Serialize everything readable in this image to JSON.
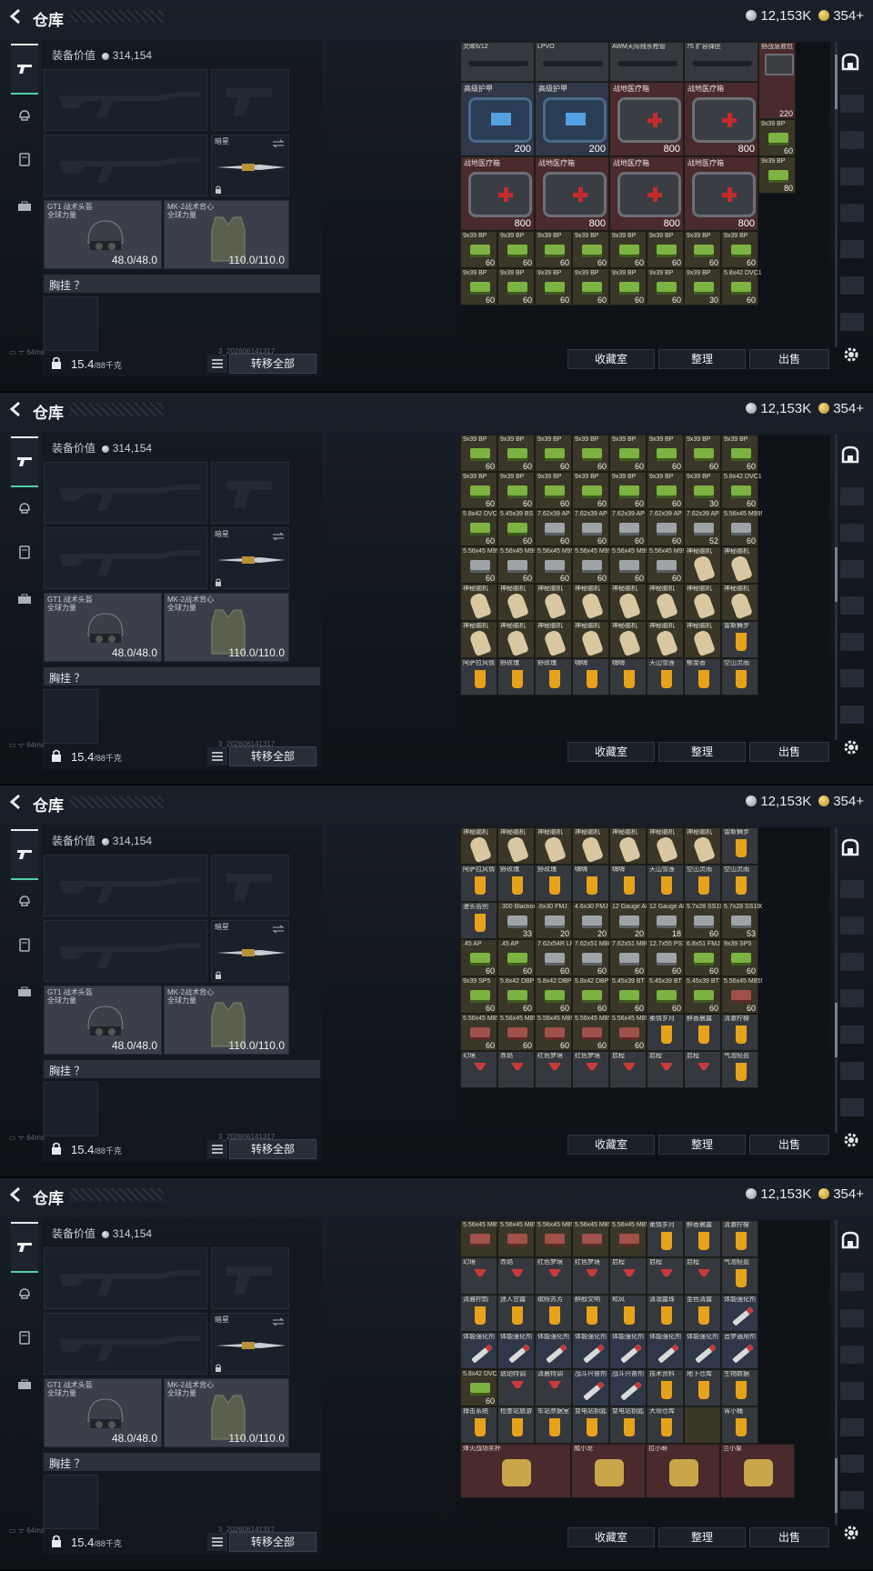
{
  "title": "仓库",
  "currency": {
    "silver": "12,153K",
    "gold": "354+"
  },
  "equipment_value_label": "装备价值",
  "equipment_value": "314,154",
  "slots": {
    "melee_name": "暗星",
    "helmet_name": "GT1 战术头盔",
    "helmet_sub": "全球力量",
    "helmet_dur": "48.0/48.0",
    "vest_name": "MK-2战术背心",
    "vest_sub": "全球力量",
    "vest_dur": "110.0/110.0"
  },
  "chest_rig_label": "胸挂 ？",
  "weight": "15.4",
  "weight_unit": "/88千克",
  "transfer_all": "转移全部",
  "buttons": {
    "collection": "收藏室",
    "sort": "整理",
    "sell": "出售"
  },
  "status": {
    "ping": "64ms",
    "build": "3_202606141317"
  },
  "icons": [
    "back-icon",
    "gun-tab-icon",
    "helmet-tab-icon",
    "vest-tab-icon",
    "case-tab-icon",
    "lock-icon",
    "list-icon",
    "gear-icon",
    "backpack-icon"
  ],
  "frames": [
    {
      "scroll": 0.05,
      "top_row": [
        {
          "nm": "灵眸6/12"
        },
        {
          "nm": "LPVO"
        },
        {
          "nm": "AWM天际线长枪管"
        },
        {
          "nm": "75 扩容弹匣"
        }
      ],
      "big": [
        {
          "nm": "高级护甲",
          "ct": "200",
          "style": "blue"
        },
        {
          "nm": "高级护甲",
          "ct": "200",
          "style": "blue"
        },
        {
          "nm": "战地医疗箱",
          "ct": "800",
          "style": "red"
        },
        {
          "nm": "战地医疗箱",
          "ct": "800",
          "style": "red"
        },
        {
          "nm": "战地医疗箱",
          "ct": "800",
          "style": "red"
        },
        {
          "nm": "战地医疗箱",
          "ct": "800",
          "style": "red"
        },
        {
          "nm": "战地医疗箱",
          "ct": "800",
          "style": "red"
        },
        {
          "nm": "战地医疗箱",
          "ct": "800",
          "style": "red"
        }
      ],
      "side": [
        {
          "nm": "野战急救包",
          "ct": "220"
        },
        {
          "nm": "9x39 BP",
          "ct": "60"
        },
        {
          "nm": "9x39 BP",
          "ct": "80"
        }
      ],
      "rows": [
        [
          "9x39 BP|60",
          "9x39 BP|60",
          "9x39 BP|60",
          "9x39 BP|60",
          "9x39 BP|60",
          "9x39 BP|60",
          "9x39 BP|60",
          "9x39 BP|60"
        ],
        [
          "9x39 BP|60",
          "9x39 BP|60",
          "9x39 BP|60",
          "9x39 BP|60",
          "9x39 BP|60",
          "9x39 BP|60",
          "9x39 BP|30",
          "5.8x42 DVC12|60"
        ]
      ]
    },
    {
      "scroll": 0.45,
      "rows": [
        [
          "9x39 BP|60",
          "9x39 BP|60",
          "9x39 BP|60",
          "9x39 BP|60",
          "9x39 BP|60",
          "9x39 BP|60",
          "9x39 BP|60",
          "9x39 BP|60"
        ],
        [
          "9x39 BP|60",
          "9x39 BP|60",
          "9x39 BP|60",
          "9x39 BP|60",
          "9x39 BP|60",
          "9x39 BP|60",
          "9x39 BP|30",
          "5.8x42 DVC12|60"
        ],
        [
          "5.8x42 DVC12|60",
          "5.45x39 BS|60",
          "7.62x39 AP|60",
          "7.62x39 AP|60",
          "7.62x39 AP|60",
          "7.62x39 AP|60",
          "7.62x39 AP|52",
          "5.56x45 M995|60"
        ],
        [
          "5.56x45 M995|60",
          "5.56x45 M995|60",
          "5.56x45 M995|60",
          "5.56x45 M995|60",
          "5.56x45 M995|60",
          "5.56x45 M995|60",
          "神秘脑机|",
          "神秘脑机|"
        ],
        [
          "神秘脑机|",
          "神秘脑机|",
          "神秘脑机|",
          "神秘脑机|",
          "神秘脑机|",
          "神秘脑机|",
          "神秘脑机|",
          "神秘脑机|"
        ],
        [
          "神秘脑机|",
          "神秘脑机|",
          "神秘脑机|",
          "神秘脑机|",
          "神秘脑机|",
          "神秘脑机|",
          "神秘脑机|",
          "雷斯舞步|"
        ],
        [
          "阿萨拉风情|",
          "野玫瑰|",
          "野玫瑰|",
          "嗨嗨|",
          "嗨嗨|",
          "天山雪莲|",
          "郁金香|",
          "空山灵雨|"
        ]
      ]
    },
    {
      "scroll": 0.7,
      "rows": [
        [
          "神秘脑机|",
          "神秘脑机|",
          "神秘脑机|",
          "神秘脑机|",
          "神秘脑机|",
          "神秘脑机|",
          "神秘脑机|",
          "雷斯舞步|"
        ],
        [
          "阿萨拉风情|",
          "野玫瑰|",
          "野玫瑰|",
          "嗨嗨|",
          "嗨嗨|",
          "天山雪莲|",
          "空山灵雨|",
          "空山灵雨|"
        ],
        [
          "漫长告别|",
          ".300 Blackout|33",
          ".6x30 FMJ|20",
          "4.6x30 FMJ|20",
          "12 Gauge AP|20",
          "12 Gauge AP|18",
          "5.7x28 SS190|60",
          "5.7x28 SS190|53"
        ],
        [
          ".45 AP|60",
          ".45 AP|60",
          "7.62x54R LPS|60",
          "7.62x51 M80|60",
          "7.62x51 M80|60",
          "12.7x55 PS12|60",
          "6.8x51 FMJ|60",
          "9x39 SP5|60"
        ],
        [
          "9x39 SP5|60",
          "5.8x42 DBP10|60",
          "5.8x42 DBP10|60",
          "5.8x42 DBP10|60",
          "5.45x39 BT|60",
          "5.45x39 BT|60",
          "5.45x39 BT|60",
          "5.56x45 M855A1|60"
        ],
        [
          "5.56x45 M855A1|60",
          "5.56x45 M855A1|60",
          "5.56x45 M855A1|60",
          "5.56x45 M855A1|60",
          "5.56x45 M855A1|60",
          "柔情岁月|",
          "醉香晨露|",
          "清澈柠檬|"
        ],
        [
          "幻境|",
          "赤焰|",
          "红色梦境|",
          "红色梦境|",
          "启程|",
          "启程|",
          "启程|",
          "气泡轻盈|"
        ]
      ]
    },
    {
      "scroll": 0.95,
      "rows": [
        [
          "5.56x45 M855A1|",
          "5.56x45 M855A1|",
          "5.56x45 M855A1|",
          "5.56x45 M855A1|",
          "5.56x45 M855A1|",
          "柔情岁月|",
          "醉香晨露|",
          "清澈柠檬|"
        ],
        [
          "幻境|",
          "赤焰|",
          "红色梦境|",
          "红色梦境|",
          "启程|",
          "启程|",
          "启程|",
          "气泡轻盈|"
        ],
        [
          "清雅柠韵|",
          "迷人甘露|",
          "缤纷苏芳|",
          "醉醇交响|",
          "和风|",
          "清凛露珠|",
          "金色清露|",
          "体能强化剂|"
        ],
        [
          "体能强化剂|",
          "体能强化剂|",
          "体能强化剂|",
          "体能强化剂|",
          "体能强化剂|",
          "体能强化剂|",
          "体能强化剂|",
          "音梦通用剂|"
        ],
        [
          "5.8x42 DVC12|60",
          "琥珀特调|",
          "清晨特调|",
          "战斗兴奋剂|",
          "战斗兴奋剂|",
          "技术资料|",
          "地下仓库|",
          "生物数据|"
        ],
        [
          "搏击系统|",
          "检查站旅游|",
          "车站票据室|",
          "变电站钥匙|",
          "变电站钥匙|",
          "大坝仓库|",
          "",
          "宵小桶|"
        ]
      ],
      "collectibles": [
        "烽火战场奖杯",
        "威小龙",
        "拉小萌",
        "兰小象"
      ]
    }
  ]
}
